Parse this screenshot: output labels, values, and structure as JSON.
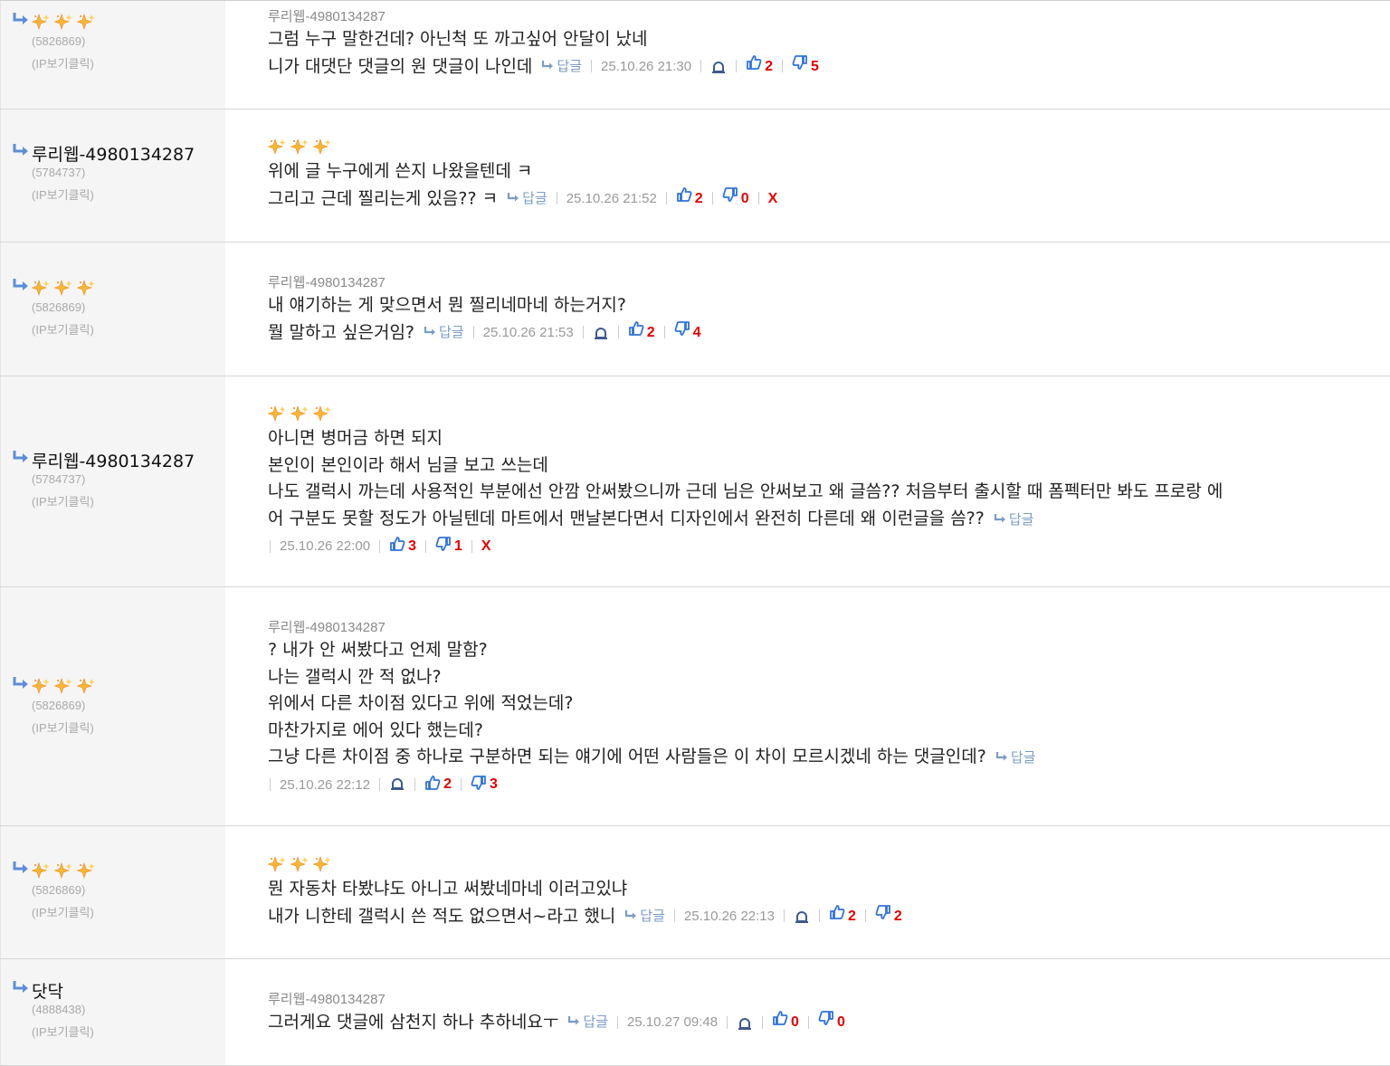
{
  "comments": [
    {
      "author_sparkles": true,
      "author": "",
      "uid": "(5826869)",
      "ip": "(IP보기클릭)",
      "target": "루리웹-4980134287",
      "body_sparkles": false,
      "lines": [
        "그럼 누구 말한건데? 아닌척 또 까고싶어 안달이 났네",
        "니가 대댓단 댓글의 원 댓글이 나인데"
      ],
      "reply_label": "답글",
      "date": "25.10.26 21:30",
      "bell": true,
      "up": "2",
      "down": "5",
      "x": ""
    },
    {
      "author_sparkles": false,
      "author": "루리웹-4980134287",
      "uid": "(5784737)",
      "ip": "(IP보기클릭)",
      "target": "",
      "body_sparkles": true,
      "lines": [
        "위에 글 누구에게 쓴지 나왔을텐데 ㅋ",
        "그리고 근데 찔리는게 있음?? ㅋ"
      ],
      "reply_label": "답글",
      "date": "25.10.26 21:52",
      "bell": false,
      "up": "2",
      "down": "0",
      "x": "X"
    },
    {
      "author_sparkles": true,
      "author": "",
      "uid": "(5826869)",
      "ip": "(IP보기클릭)",
      "target": "루리웹-4980134287",
      "body_sparkles": false,
      "lines": [
        "내 얘기하는 게 맞으면서 뭔 찔리네마네 하는거지?",
        "뭘 말하고 싶은거임?"
      ],
      "reply_label": "답글",
      "date": "25.10.26 21:53",
      "bell": true,
      "up": "2",
      "down": "4",
      "x": ""
    },
    {
      "author_sparkles": false,
      "author": "루리웹-4980134287",
      "uid": "(5784737)",
      "ip": "(IP보기클릭)",
      "target": "",
      "body_sparkles": true,
      "lines": [
        "아니면 병머금 하면 되지",
        "본인이 본인이라 해서 님글 보고 쓰는데",
        "나도 갤럭시 까는데 사용적인 부분에선 안깜 안써봤으니까 근데 님은 안써보고 왜 글씀?? 처음부터 출시할 때 폼펙터만 봐도 프로랑 에",
        "어 구분도 못할 정도가 아닐텐데 마트에서 맨날본다면서 디자인에서 완전히 다른데 왜 이런글을 씀??"
      ],
      "reply_label": "답글",
      "date": "25.10.26 22:00",
      "bell": false,
      "up": "3",
      "down": "1",
      "x": "X"
    },
    {
      "author_sparkles": true,
      "author": "",
      "uid": "(5826869)",
      "ip": "(IP보기클릭)",
      "target": "루리웹-4980134287",
      "body_sparkles": false,
      "lines": [
        "? 내가 안 써봤다고 언제 말함?",
        "나는 갤럭시 깐 적 없나?",
        "위에서 다른 차이점 있다고 위에 적었는데?",
        "마찬가지로 에어 있다 했는데?",
        "그냥 다른 차이점 중 하나로 구분하면 되는 얘기에 어떤 사람들은 이 차이 모르시겠네 하는 댓글인데?"
      ],
      "reply_label": "답글",
      "date": "25.10.26 22:12",
      "bell": true,
      "up": "2",
      "down": "3",
      "x": ""
    },
    {
      "author_sparkles": true,
      "author": "",
      "uid": "(5826869)",
      "ip": "(IP보기클릭)",
      "target": "",
      "body_sparkles": true,
      "lines": [
        "뭔 자동차 타봤냐도 아니고 써봤네마네 이러고있냐",
        "내가 니한테 갤럭시 쓴 적도 없으면서~라고 했니"
      ],
      "reply_label": "답글",
      "date": "25.10.26 22:13",
      "bell": true,
      "up": "2",
      "down": "2",
      "x": ""
    },
    {
      "author_sparkles": false,
      "author": "닷닥",
      "uid": "(4888438)",
      "ip": "(IP보기클릭)",
      "target": "루리웹-4980134287",
      "body_sparkles": false,
      "lines": [
        "그러게요 댓글에 삼천지 하나 추하네요ㅜ"
      ],
      "reply_label": "답글",
      "date": "25.10.27 09:48",
      "bell": true,
      "up": "0",
      "down": "0",
      "x": ""
    }
  ],
  "colors": {
    "vote": "#e60000",
    "thumb": "#2f73d9",
    "reply": "#7a9cc6",
    "sparkle": "#f5a623"
  },
  "icons": {
    "reply": "reply-arrow-icon",
    "bell": "bell-icon",
    "up": "thumbs-up-icon",
    "down": "thumbs-down-icon",
    "sparkle": "sparkle-icon"
  }
}
